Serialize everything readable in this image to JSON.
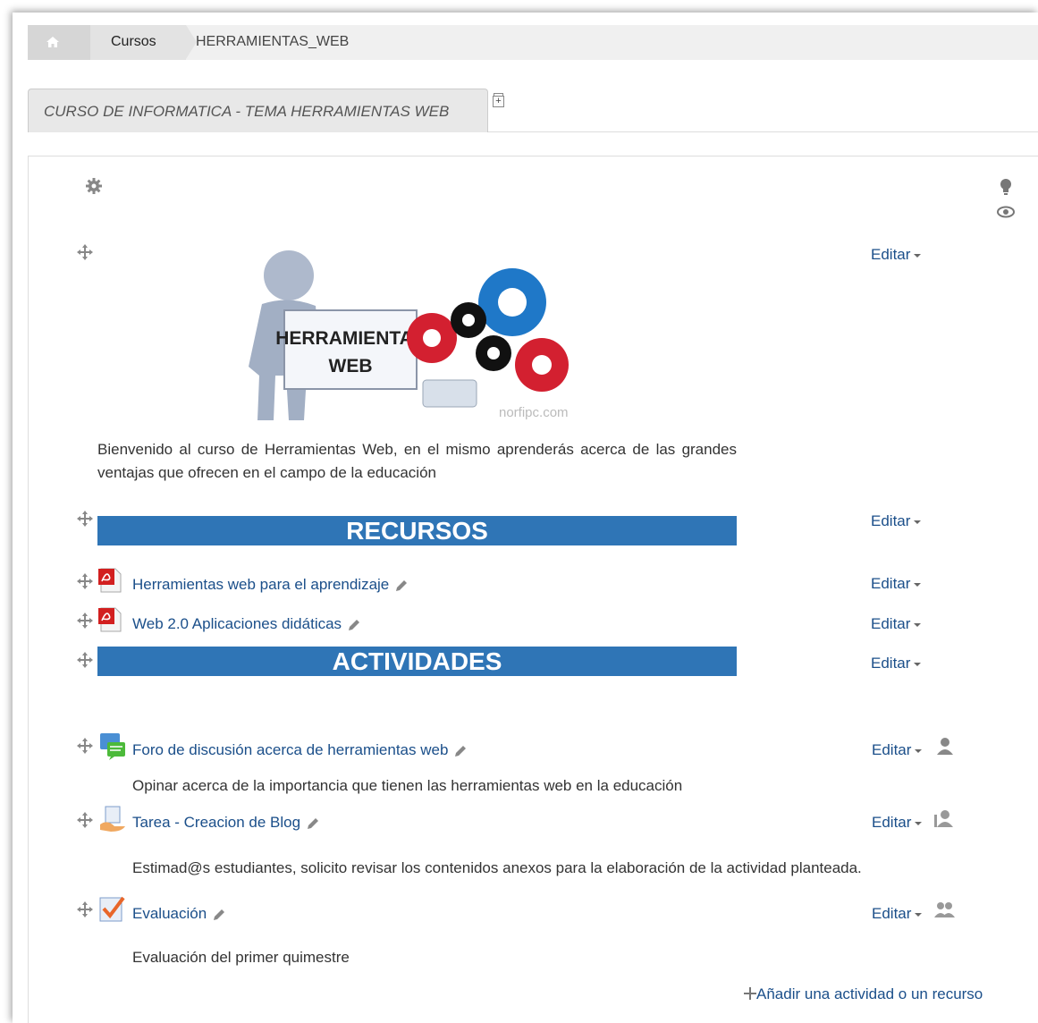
{
  "breadcrumb": {
    "home_icon": "home-icon",
    "cursos": "Cursos",
    "current": "HERRAMIENTAS_WEB"
  },
  "tab": {
    "label": "CURSO DE INFORMATICA - TEMA HERRAMIENTAS WEB",
    "add_icon": "add-tab-icon"
  },
  "section": {
    "settings_icon": "gear-icon",
    "highlight_icon": "lightbulb-icon",
    "visibility_icon": "eye-icon"
  },
  "banner_image": {
    "sign_line1": "HERRAMIENTAS",
    "sign_line2": "WEB",
    "watermark": "norfipc.com"
  },
  "welcome_text": "Bienvenido al curso de Herramientas Web, en el mismo aprenderás acerca de las grandes ventajas que ofrecen en el campo de la educación",
  "edit_label": "Editar",
  "recursos_label": "RECURSOS",
  "actividades_label": "ACTIVIDADES",
  "resources": [
    {
      "title": "Herramientas web para el aprendizaje",
      "icon": "pdf-icon"
    },
    {
      "title": "Web 2.0 Aplicaciones didáticas",
      "icon": "pdf-icon"
    }
  ],
  "activities": [
    {
      "title": "Foro de discusión acerca de herramientas web",
      "icon": "forum-icon",
      "description": "Opinar acerca de la importancia que tienen las herramientas web en la educación",
      "group_icon": "no-groups-icon"
    },
    {
      "title": "Tarea - Creacion de Blog",
      "icon": "assignment-icon",
      "description": "Estimad@s estudiantes, solicito revisar los contenidos anexos para la elaboración de la actividad planteada.",
      "group_icon": "separate-groups-icon"
    },
    {
      "title": "Evaluación",
      "icon": "quiz-icon",
      "description": "Evaluación del primer quimestre",
      "group_icon": "visible-groups-icon"
    }
  ],
  "add_activity": "Añadir una actividad o un recurso",
  "colors": {
    "banner": "#2f75b6",
    "link": "#1b4f8a"
  }
}
